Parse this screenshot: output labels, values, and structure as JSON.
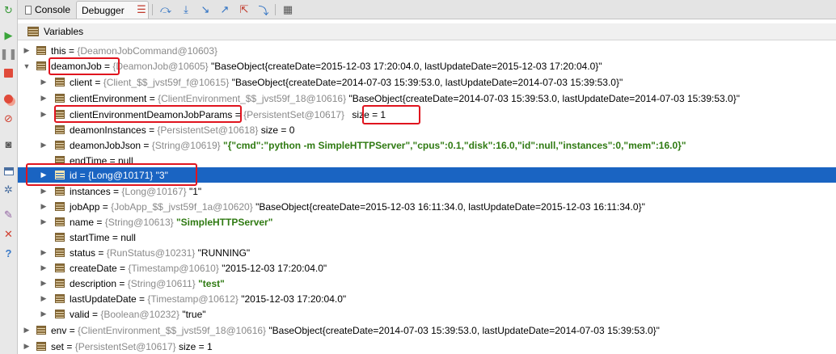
{
  "tabs": [
    {
      "label": "Console"
    },
    {
      "label": "Debugger"
    }
  ],
  "panel": {
    "title": "Variables"
  },
  "tree": [
    {
      "name": "this",
      "meta": "{DeamonJobCommand@10603}",
      "value": "",
      "arrow": "▶"
    },
    {
      "name": "deamonJob",
      "meta": "{DeamonJob@10605}",
      "value": "\"BaseObject{createDate=2015-12-03 17:20:04.0, lastUpdateDate=2015-12-03 17:20:04.0}\"",
      "arrow": "▼"
    },
    {
      "name": "client",
      "meta": "{Client_$$_jvst59f_f@10615}",
      "value": "\"BaseObject{createDate=2014-07-03 15:39:53.0, lastUpdateDate=2014-07-03 15:39:53.0}\"",
      "arrow": "▶"
    },
    {
      "name": "clientEnvironment",
      "meta": "{ClientEnvironment_$$_jvst59f_18@10616}",
      "value": "\"BaseObject{createDate=2014-07-03 15:39:53.0, lastUpdateDate=2014-07-03 15:39:53.0}\"",
      "arrow": "▶"
    },
    {
      "name": "clientEnvironmentDeamonJobParams",
      "meta": "{PersistentSet@10617}",
      "value": "size = 1",
      "arrow": "▶"
    },
    {
      "name": "deamonInstances",
      "meta": "{PersistentSet@10618}",
      "value": "size = 0",
      "arrow": ""
    },
    {
      "name": "deamonJobJson",
      "meta": "{String@10619}",
      "value": "\"{\"cmd\":\"python -m SimpleHTTPServer\",\"cpus\":0.1,\"disk\":16.0,\"id\":null,\"instances\":0,\"mem\":16.0}\"",
      "arrow": "▶"
    },
    {
      "name": "endTime",
      "meta": "",
      "value": "null",
      "arrow": ""
    },
    {
      "name": "id",
      "meta": "{Long@10171}",
      "value": "\"3\"",
      "arrow": "▶"
    },
    {
      "name": "instances",
      "meta": "{Long@10167}",
      "value": "\"1\"",
      "arrow": "▶"
    },
    {
      "name": "jobApp",
      "meta": "{JobApp_$$_jvst59f_1a@10620}",
      "value": "\"BaseObject{createDate=2015-12-03 16:11:34.0, lastUpdateDate=2015-12-03 16:11:34.0}\"",
      "arrow": "▶"
    },
    {
      "name": "name",
      "meta": "{String@10613}",
      "value": "\"SimpleHTTPServer\"",
      "arrow": "▶"
    },
    {
      "name": "startTime",
      "meta": "",
      "value": "null",
      "arrow": ""
    },
    {
      "name": "status",
      "meta": "{RunStatus@10231}",
      "value": "\"RUNNING\"",
      "arrow": "▶"
    },
    {
      "name": "createDate",
      "meta": "{Timestamp@10610}",
      "value": "\"2015-12-03 17:20:04.0\"",
      "arrow": "▶"
    },
    {
      "name": "description",
      "meta": "{String@10611}",
      "value": "\"test\"",
      "arrow": "▶"
    },
    {
      "name": "lastUpdateDate",
      "meta": "{Timestamp@10612}",
      "value": "\"2015-12-03 17:20:04.0\"",
      "arrow": "▶"
    },
    {
      "name": "valid",
      "meta": "{Boolean@10232}",
      "value": "\"true\"",
      "arrow": "▶"
    },
    {
      "name": "env",
      "meta": "{ClientEnvironment_$$_jvst59f_18@10616}",
      "value": "\"BaseObject{createDate=2014-07-03 15:39:53.0, lastUpdateDate=2014-07-03 15:39:53.0}\"",
      "arrow": "▶"
    },
    {
      "name": "set",
      "meta": "{PersistentSet@10617}",
      "value": "size = 1",
      "arrow": "▶"
    }
  ],
  "colors": {
    "selection": "#1a64c2",
    "highlight_box": "#e0141e",
    "string_value": "#2f7a12"
  },
  "icons": {
    "left_toolbar": [
      "rerun-icon",
      "resume-icon",
      "pause-icon",
      "stop-icon",
      "breakpoints-icon",
      "mute-breakpoints-icon",
      "camera-icon",
      "layout-icon",
      "settings-icon",
      "pin-icon",
      "close-icon",
      "help-icon"
    ],
    "top_toolbar": [
      "show-execution-point-icon",
      "step-over-icon",
      "step-into-icon",
      "force-step-into-icon",
      "step-out-icon",
      "drop-frame-icon",
      "run-to-cursor-icon",
      "evaluate-expression-icon"
    ]
  }
}
